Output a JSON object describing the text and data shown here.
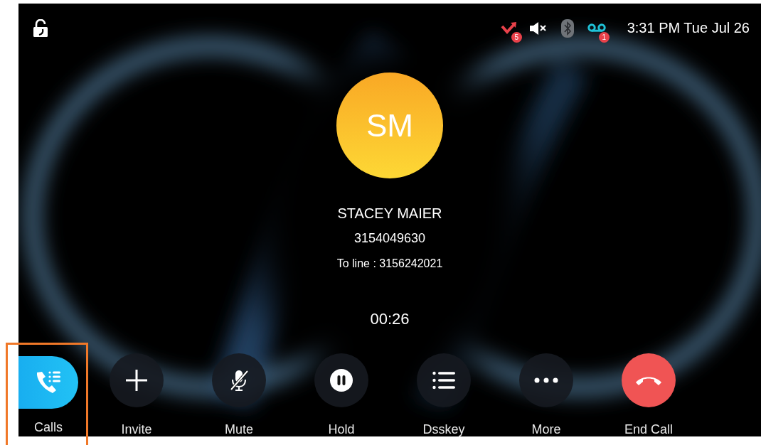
{
  "status_bar": {
    "indicators": [
      {
        "kind": "missed",
        "badge": "5"
      },
      {
        "kind": "muted"
      },
      {
        "kind": "bluetooth"
      },
      {
        "kind": "voicemail",
        "badge": "1"
      }
    ],
    "time": "3:31 PM Tue Jul 26"
  },
  "caller": {
    "initials": "SM",
    "name": "STACEY MAIER",
    "number": "3154049630",
    "line": "To line : 3156242021",
    "duration": "00:26"
  },
  "actions": [
    {
      "kind": "calls",
      "label": "Calls",
      "selected": true,
      "highlighted": true
    },
    {
      "kind": "invite",
      "label": "Invite",
      "selected": false,
      "highlighted": false
    },
    {
      "kind": "mute",
      "label": "Mute",
      "selected": false,
      "highlighted": false
    },
    {
      "kind": "hold",
      "label": "Hold",
      "selected": false,
      "highlighted": false
    },
    {
      "kind": "dsskey",
      "label": "Dsskey",
      "selected": false,
      "highlighted": false
    },
    {
      "kind": "more",
      "label": "More",
      "selected": false,
      "highlighted": false
    },
    {
      "kind": "end",
      "label": "End Call",
      "selected": false,
      "highlighted": false
    }
  ]
}
